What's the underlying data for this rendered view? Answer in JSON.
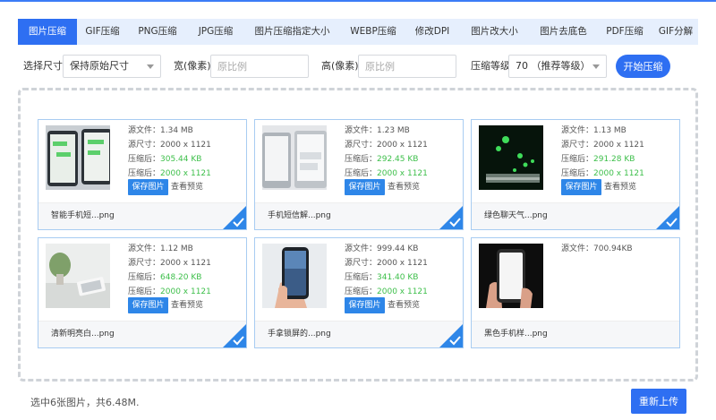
{
  "tabs": [
    {
      "label": "图片压缩",
      "active": true
    },
    {
      "label": "GIF压缩"
    },
    {
      "label": "PNG压缩"
    },
    {
      "label": "JPG压缩"
    },
    {
      "label": "图片压缩指定大小"
    },
    {
      "label": "WEBP压缩"
    },
    {
      "label": "修改DPI"
    },
    {
      "label": "图片改大小"
    },
    {
      "label": "图片去底色"
    },
    {
      "label": "PDF压缩"
    },
    {
      "label": "GIF分解"
    }
  ],
  "options": {
    "size_label": "选择尺寸",
    "size_value": "保持原始尺寸",
    "width_label": "宽(像素)",
    "width_placeholder": "原比例",
    "height_label": "高(像素)",
    "height_placeholder": "原比例",
    "level_label": "压缩等级",
    "level_value": "70 （推荐等级）",
    "start_button": "开始压缩"
  },
  "labels": {
    "source_file": "源文件：",
    "source_size": "源尺寸：",
    "compressed": "压缩后：",
    "compressed_size": "压缩后：",
    "save": "保存图片",
    "preview": "查看预览"
  },
  "files": [
    {
      "name": "智能手机短...png",
      "src_file": "1.34 MB",
      "src_dim": "2000 x 1121",
      "out_file": "305.44 KB",
      "out_dim": "2000 x 1121",
      "done": true
    },
    {
      "name": "手机短信解...png",
      "src_file": "1.23 MB",
      "src_dim": "2000 x 1121",
      "out_file": "292.45 KB",
      "out_dim": "2000 x 1121",
      "done": true
    },
    {
      "name": "绿色聊天气...png",
      "src_file": "1.13 MB",
      "src_dim": "2000 x 1121",
      "out_file": "291.28 KB",
      "out_dim": "2000 x 1121",
      "done": true
    },
    {
      "name": "清新明亮白...png",
      "src_file": "1.12 MB",
      "src_dim": "2000 x 1121",
      "out_file": "648.20 KB",
      "out_dim": "2000 x 1121",
      "done": true
    },
    {
      "name": "手拿锁屏的...png",
      "src_file": "999.44 KB",
      "src_dim": "2000 x 1121",
      "out_file": "341.40 KB",
      "out_dim": "2000 x 1121",
      "done": true
    },
    {
      "name": "黑色手机样...png",
      "src_file": "700.94KB",
      "done": false,
      "progress": 1.0
    }
  ],
  "footer": {
    "summary": "选中6张图片，共6.48M.",
    "reupload": "重新上传"
  },
  "colors": {
    "accent": "#2e6ff2",
    "tab_bg": "#e6effd",
    "success": "#3dbf4a",
    "card_border": "#a8ccf2"
  }
}
